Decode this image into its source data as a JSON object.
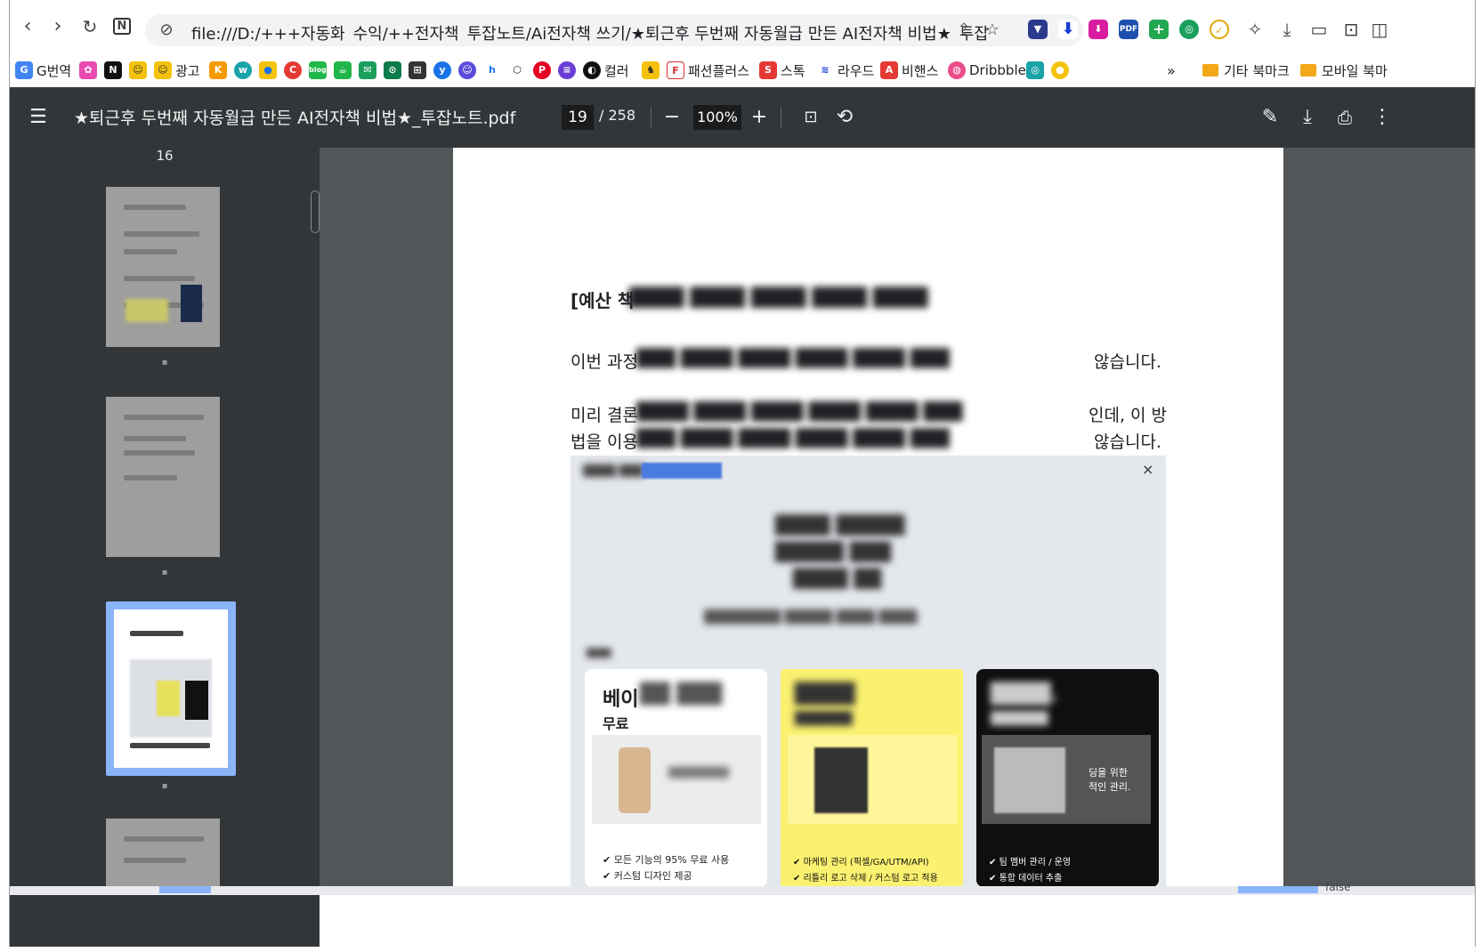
{
  "url": "file:///D:/+++자동화_수익/++전자책_투잡노트/Ai전자책 쓰기/★퇴근후 두번째 자동월급 만든 AI전자책 비법★_투잡",
  "bookmarks": {
    "gtranslate": "G번역",
    "ad": "광고",
    "color": "컬러",
    "fashion": "패션플러스",
    "stock": "스톡",
    "round": "라우드",
    "behance": "비핸스",
    "dribbble": "Dribbble",
    "more": "»",
    "other": "기타 북마크",
    "mobile": "모바일 북마"
  },
  "viewer": {
    "title": "★퇴근후 두번째 자동월급 만든 AI전자책 비법★_투잡노트.pdf",
    "page": "19",
    "total": "/ 258",
    "zoom": "100%"
  },
  "sidebar": {
    "page_label": "16"
  },
  "content": {
    "heading": "[예산 책",
    "line1_start": "이번 과정",
    "line1_end": "않습니다.",
    "line2_start": "미리 결론",
    "line2_end": "인데, 이 방",
    "line3_start": "법을 이용",
    "line3_end": "않습니다.",
    "card1_title": "베이",
    "card1_sub": "무료",
    "card1_f1": "모든 기능의 95% 무료 사용",
    "card1_f2": "커스텀 디자인 제공",
    "card2_f1": "마케팅 관리 (픽셀/GA/UTM/API)",
    "card2_f2": "리틀리 로고 삭제 / 커스텀 로고 적용",
    "card3_text": "팀 멤버 관리 / 운영",
    "card3_f2": "통합 데이터 추출",
    "card3_side": "딩을 위한\n적인 관리.",
    "close": "×",
    "false_text": "false"
  }
}
